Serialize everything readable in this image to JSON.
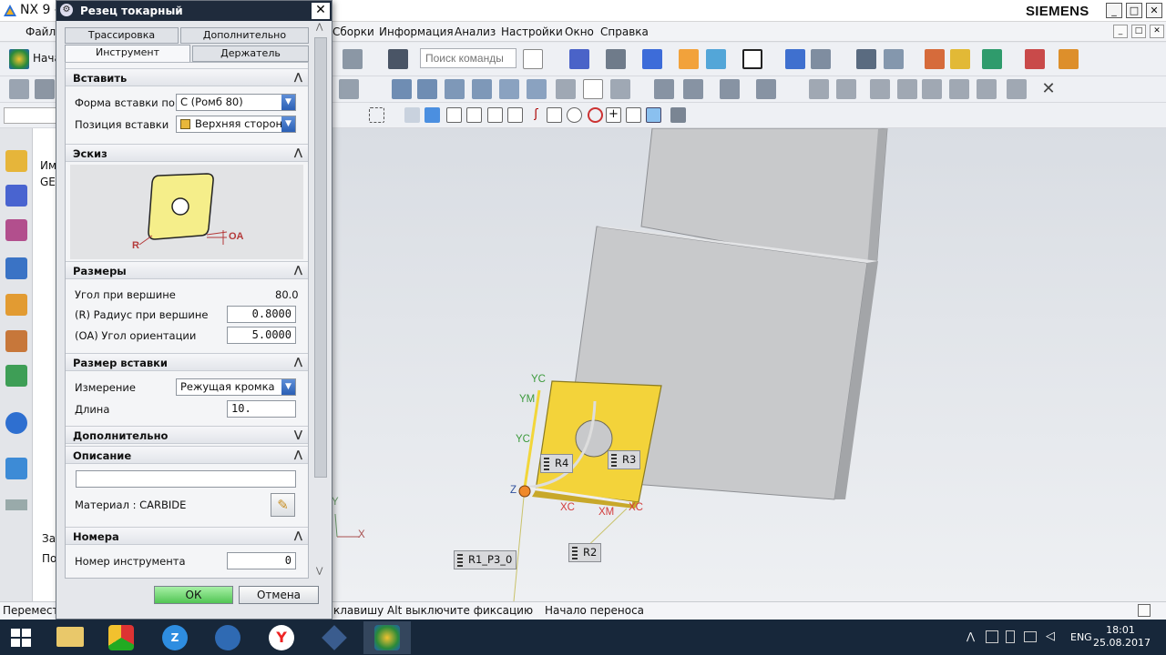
{
  "window": {
    "title": "NX 9 -",
    "brand": "SIEMENS",
    "min": "_",
    "max": "□",
    "close": "✕"
  },
  "menu": {
    "visible_items": [
      "Файл",
      "Сборки",
      "Информация",
      "Анализ",
      "Настройки",
      "Окно",
      "Справка"
    ],
    "start_label": "Нача"
  },
  "search": {
    "placeholder": "Поиск команды"
  },
  "nav": {
    "col_header": "Им",
    "row1": "GE",
    "bottom1": "За",
    "bottom2": "По"
  },
  "dialog": {
    "title": "Резец токарный",
    "close": "✕",
    "tabs": {
      "trace": "Трассировка",
      "extra": "Дополнительно",
      "tool": "Инструмент",
      "holder": "Держатель",
      "active": "tool"
    },
    "insert": {
      "header": "Вставить",
      "shape_label": "Форма вставки по IS",
      "shape_value": "C (Ромб 80)",
      "position_label": "Позиция вставки",
      "position_value": "Верхняя сторона"
    },
    "sketch": {
      "header": "Эскиз",
      "label_r": "R",
      "label_oa": "OA"
    },
    "dims": {
      "header": "Размеры",
      "angle_label": "Угол при вершине",
      "angle_value": "80.0",
      "radius_label": "(R) Радиус при вершине",
      "radius_value": "0.8000",
      "orient_label": "(OA) Угол ориентации",
      "orient_value": "5.0000"
    },
    "size": {
      "header": "Размер вставки",
      "measure_label": "Измерение",
      "measure_value": "Режущая кромка",
      "length_label": "Длина",
      "length_value": "10."
    },
    "additional": {
      "header": "Дополнительно"
    },
    "description": {
      "header": "Описание",
      "value": "",
      "material_label": "Материал : CARBIDE"
    },
    "numbers": {
      "header": "Номера",
      "tool_number_label": "Номер инструмента",
      "tool_number_value": "0"
    },
    "ok": "ОК",
    "cancel": "Отмена"
  },
  "viewport": {
    "labels": {
      "r1": "R1_P3_0",
      "r2": "R2",
      "r3": "R3",
      "r4": "R4"
    },
    "axes": {
      "yc1": "YC",
      "ym": "YM",
      "yc2": "YC",
      "z": "Z",
      "xc1": "XC",
      "xm": "XM",
      "xc2": "XC",
      "y": "Y",
      "x": "X"
    },
    "colors": {
      "insert": "#f3d33a",
      "holder": "#c8c9cb",
      "bg_top": "#d9dde3"
    }
  },
  "status": {
    "left": "Перемест",
    "mid": "клавишу Alt выключите фиксацию",
    "right": "Начало переноса"
  },
  "taskbar": {
    "lang": "ENG",
    "time": "18:01",
    "date": "25.08.2017"
  }
}
